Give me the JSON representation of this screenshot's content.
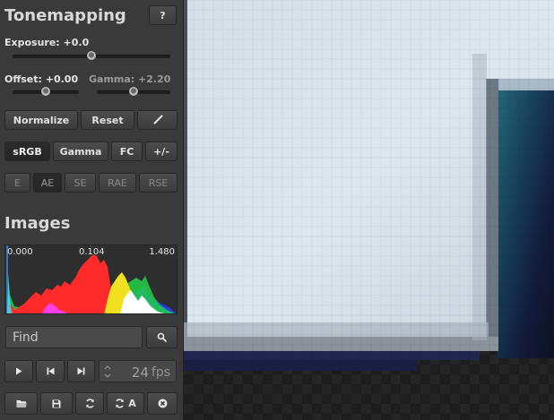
{
  "panel": {
    "title": "Tonemapping",
    "help_label": "?",
    "exposure_label": "Exposure: +0.0",
    "exposure_value": 0.5,
    "offset_label": "Offset: +0.00",
    "offset_value": 0.5,
    "gamma_label": "Gamma: +2.20",
    "gamma_value": 0.5,
    "normalize_label": "Normalize",
    "reset_label": "Reset",
    "colorspace_buttons": [
      "sRGB",
      "Gamma",
      "FC",
      "+/-"
    ],
    "colorspace_selected": "sRGB",
    "metric_buttons": [
      "E",
      "AE",
      "SE",
      "RAE",
      "RSE"
    ],
    "metric_selected": "AE"
  },
  "images": {
    "title": "Images",
    "histogram_min": "0.000",
    "histogram_mid": "0.104",
    "histogram_max": "1.480",
    "search_placeholder": "Find",
    "fps_value": "24",
    "fps_unit": "fps"
  },
  "icons": [
    "brush-icon",
    "search-icon",
    "play-icon",
    "skip-back-icon",
    "skip-forward-icon",
    "folder-open-icon",
    "save-icon",
    "refresh-icon",
    "refresh-all-icon",
    "close-icon"
  ],
  "reload_all_label": "A",
  "colors": {
    "panel_bg": "#3a3a3a",
    "image_light": "#d7e2ea",
    "image_teal": "#1f5b6e",
    "image_navy": "#14153a"
  }
}
